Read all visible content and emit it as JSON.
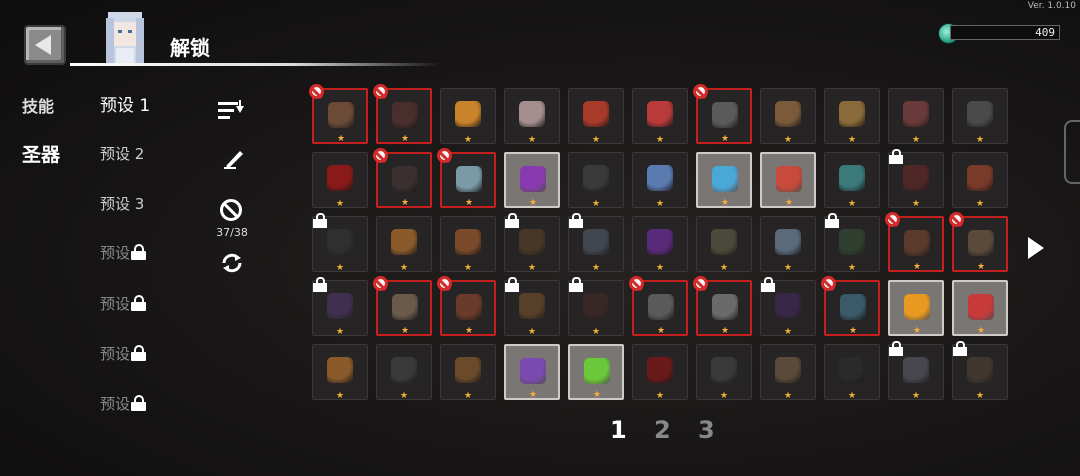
{
  "version": "Ver. 1.0.10",
  "currency": {
    "value": "409",
    "icon": "gem-icon"
  },
  "header": {
    "title": "解锁"
  },
  "categories": [
    {
      "label": "技能",
      "active": false
    },
    {
      "label": "圣器",
      "active": true
    }
  ],
  "presets": [
    {
      "label": "预设 1",
      "locked": false,
      "active": true
    },
    {
      "label": "预设 2",
      "locked": false,
      "active": false
    },
    {
      "label": "预设 3",
      "locked": false,
      "active": false
    },
    {
      "label": "预设",
      "locked": true,
      "active": false
    },
    {
      "label": "预设",
      "locked": true,
      "active": false
    },
    {
      "label": "预设",
      "locked": true,
      "active": false
    },
    {
      "label": "预设",
      "locked": true,
      "active": false
    }
  ],
  "tools": {
    "ban_count": "37/38"
  },
  "pagination": {
    "pages": [
      "1",
      "2",
      "3"
    ],
    "current": "1"
  },
  "grid": [
    [
      {
        "s": "ban",
        "c": "#6b4a36"
      },
      {
        "s": "ban",
        "c": "#4a2e2e"
      },
      {
        "s": "n",
        "c": "#c9832a"
      },
      {
        "s": "n",
        "c": "#a58e8e"
      },
      {
        "s": "n",
        "c": "#a83a2a"
      },
      {
        "s": "n",
        "c": "#b83a3a"
      },
      {
        "s": "ban",
        "c": "#5a5a5a"
      },
      {
        "s": "n",
        "c": "#7a5a3a"
      },
      {
        "s": "n",
        "c": "#8a6a3a"
      },
      {
        "s": "n",
        "c": "#6a3a3a"
      },
      {
        "s": "n",
        "c": "#4a4a4a"
      }
    ],
    [
      {
        "s": "n",
        "c": "#8a1a1a"
      },
      {
        "s": "ban",
        "c": "#3a3030"
      },
      {
        "s": "ban",
        "c": "#7a9aa8"
      },
      {
        "s": "hl",
        "c": "#8a3ab0"
      },
      {
        "s": "n",
        "c": "#3a3a3a"
      },
      {
        "s": "n",
        "c": "#5a7ab0"
      },
      {
        "s": "hl",
        "c": "#4aa8d8"
      },
      {
        "s": "hl",
        "c": "#c84a3a"
      },
      {
        "s": "n",
        "c": "#3a7a7a"
      },
      {
        "s": "lock",
        "c": "#7a2a2a"
      },
      {
        "s": "n",
        "c": "#7a3a2a"
      }
    ],
    [
      {
        "s": "lock",
        "c": "#3a3a3a"
      },
      {
        "s": "n",
        "c": "#8a5a2a"
      },
      {
        "s": "n",
        "c": "#7a4a2a"
      },
      {
        "s": "lock",
        "c": "#6a4a2a"
      },
      {
        "s": "lock",
        "c": "#5a6a7a"
      },
      {
        "s": "n",
        "c": "#5a2a7a"
      },
      {
        "s": "n",
        "c": "#4a4a3a"
      },
      {
        "s": "n",
        "c": "#5a6a7a"
      },
      {
        "s": "lock",
        "c": "#3a5a3a"
      },
      {
        "s": "ban",
        "c": "#5a3a2a"
      },
      {
        "s": "ban",
        "c": "#5a4a3a"
      }
    ],
    [
      {
        "s": "lock",
        "c": "#5a3a7a"
      },
      {
        "s": "ban",
        "c": "#6a5a4a"
      },
      {
        "s": "ban",
        "c": "#6a3a2a"
      },
      {
        "s": "lock",
        "c": "#8a5a2a"
      },
      {
        "s": "lock",
        "c": "#4a2a2a"
      },
      {
        "s": "ban",
        "c": "#5a5a5a"
      },
      {
        "s": "ban",
        "c": "#6a6a6a"
      },
      {
        "s": "lock",
        "c": "#4a2a6a"
      },
      {
        "s": "ban",
        "c": "#3a5a6a"
      },
      {
        "s": "hl",
        "c": "#e89a20"
      },
      {
        "s": "hl",
        "c": "#c83a3a"
      }
    ],
    [
      {
        "s": "n",
        "c": "#8a5a2a"
      },
      {
        "s": "n",
        "c": "#3a3a3a"
      },
      {
        "s": "n",
        "c": "#6a4a2a"
      },
      {
        "s": "hl",
        "c": "#7a4ab0"
      },
      {
        "s": "hl",
        "c": "#6ac83a"
      },
      {
        "s": "n",
        "c": "#6a1a1a"
      },
      {
        "s": "n",
        "c": "#3a3a3a"
      },
      {
        "s": "n",
        "c": "#5a4a3a"
      },
      {
        "s": "n",
        "c": "#2a2a2a"
      },
      {
        "s": "lock",
        "c": "#6a6a7a"
      },
      {
        "s": "lock",
        "c": "#5a4a3a"
      }
    ]
  ]
}
